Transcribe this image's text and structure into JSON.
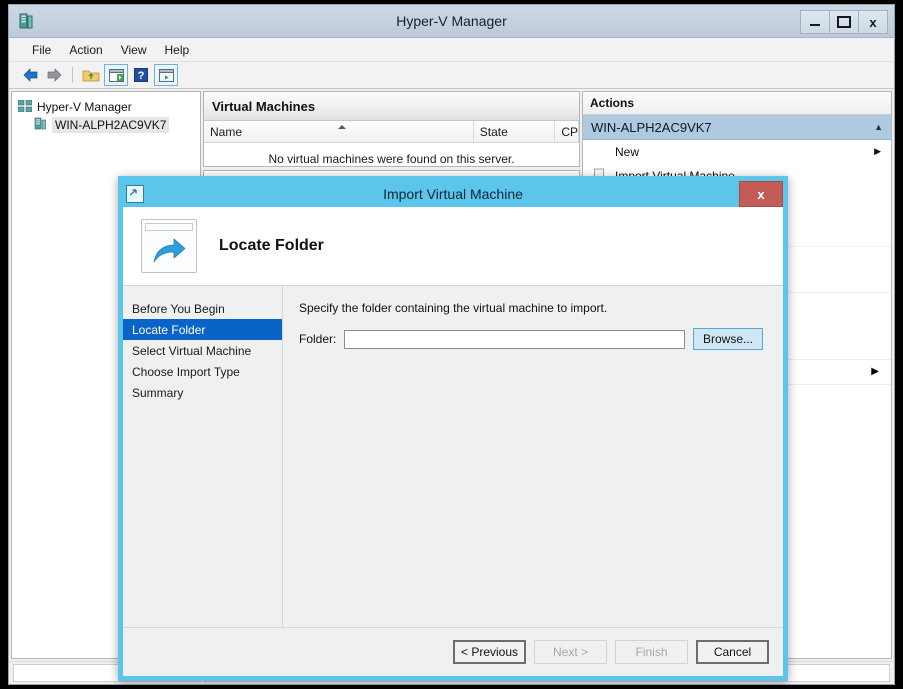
{
  "window": {
    "title": "Hyper-V Manager",
    "icon": "server-icon",
    "controls": {
      "minimize": "minimize-icon",
      "maximize": "maximize-icon",
      "close": "x"
    }
  },
  "menubar": {
    "items": [
      {
        "label": "File"
      },
      {
        "label": "Action"
      },
      {
        "label": "View"
      },
      {
        "label": "Help"
      }
    ]
  },
  "toolbar": {
    "buttons": [
      {
        "name": "back-arrow-icon"
      },
      {
        "name": "forward-arrow-icon"
      },
      {
        "name": "up-folder-icon"
      },
      {
        "name": "show-hide-console-tree-icon"
      },
      {
        "name": "help-icon"
      },
      {
        "name": "show-hide-action-pane-icon"
      }
    ]
  },
  "tree": {
    "root": {
      "label": "Hyper-V Manager",
      "icon": "console-root-icon"
    },
    "child": {
      "label": "WIN-ALPH2AC9VK7",
      "icon": "server-icon"
    }
  },
  "virtual_machines": {
    "panel_title": "Virtual Machines",
    "columns": [
      {
        "label": "Name",
        "sorted": true,
        "sort_direction": "asc"
      },
      {
        "label": "State"
      },
      {
        "label": "CP"
      }
    ],
    "empty_message": "No virtual machines were found on this server."
  },
  "actions": {
    "header": "Actions",
    "group_title": "WIN-ALPH2AC9VK7",
    "group_collapse_icon": "chevron-up-icon",
    "items": [
      {
        "label": "New",
        "icon": null,
        "submenu": true
      },
      {
        "label": "Import Virtual Machine...",
        "icon": "import-vm-icon",
        "submenu": false
      }
    ]
  },
  "dialog": {
    "title": "Import Virtual Machine",
    "title_icon": "wizard-icon",
    "close_label": "x",
    "banner": {
      "icon": "import-arrow-icon",
      "heading": "Locate Folder"
    },
    "steps": [
      {
        "label": "Before You Begin",
        "active": false
      },
      {
        "label": "Locate Folder",
        "active": true
      },
      {
        "label": "Select Virtual Machine",
        "active": false
      },
      {
        "label": "Choose Import Type",
        "active": false
      },
      {
        "label": "Summary",
        "active": false
      }
    ],
    "content": {
      "instruction": "Specify the folder containing the virtual machine to import.",
      "folder_label": "Folder:",
      "folder_value": "",
      "folder_placeholder": "",
      "browse_label": "Browse..."
    },
    "footer": {
      "previous": {
        "label": "< Previous",
        "enabled": true
      },
      "next": {
        "label": "Next >",
        "enabled": false
      },
      "finish": {
        "label": "Finish",
        "enabled": false
      },
      "cancel": {
        "label": "Cancel",
        "enabled": true
      }
    }
  },
  "colors": {
    "window_titlebar": "#c6d3e0",
    "dialog_accent": "#5bc5ec",
    "dialog_close": "#c35b56",
    "step_active": "#0a64c8",
    "actions_group": "#afc9e0"
  }
}
